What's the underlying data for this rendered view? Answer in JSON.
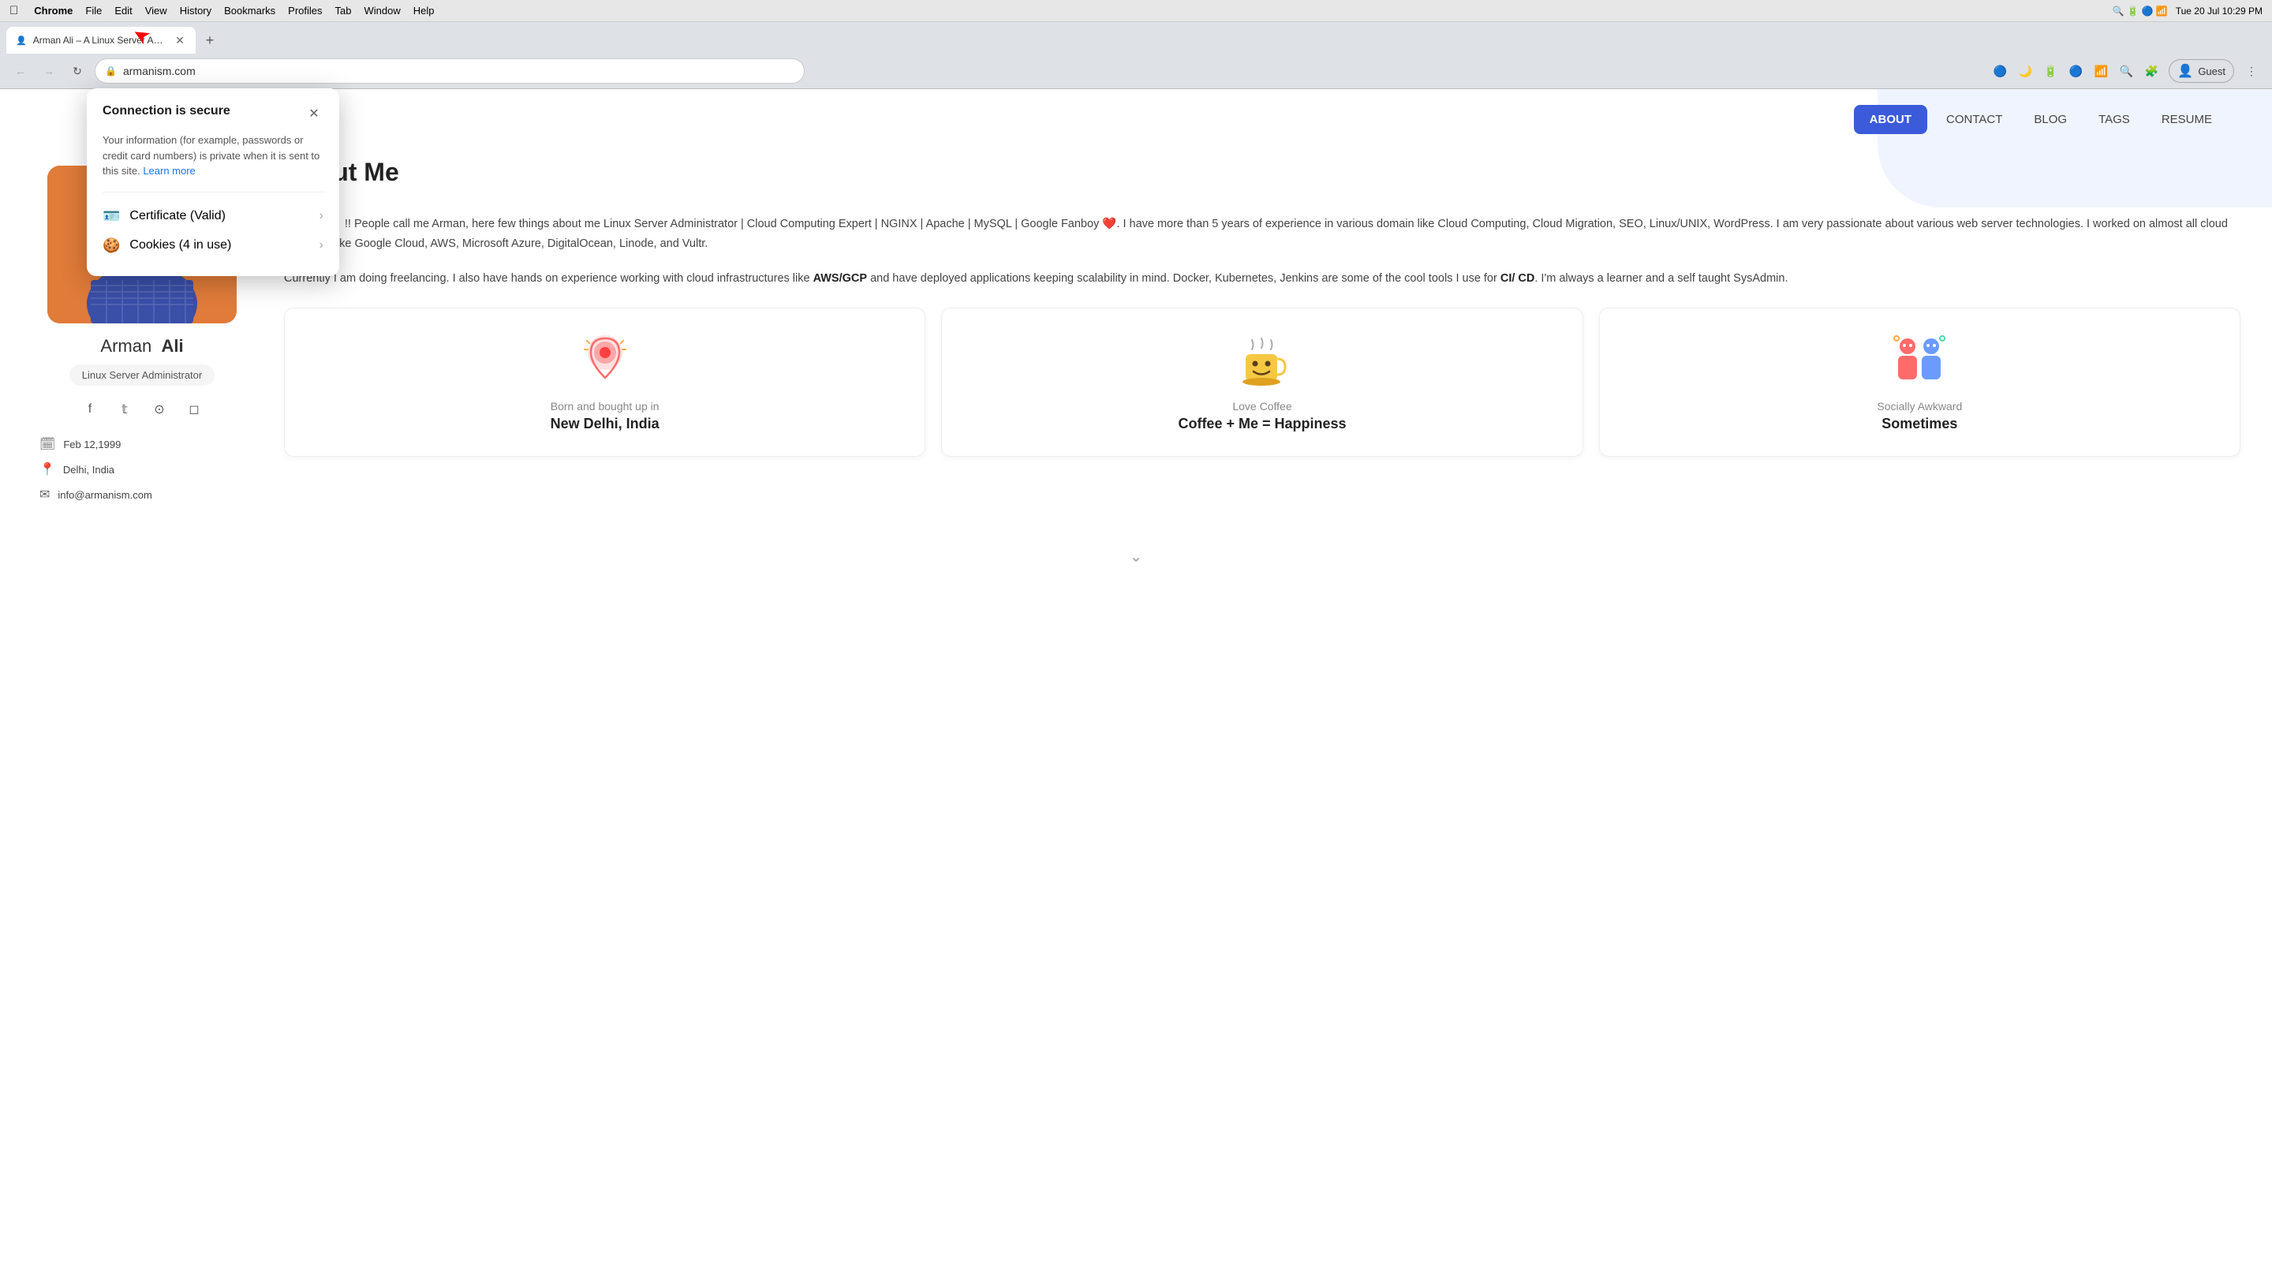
{
  "os": {
    "apple": "🍎",
    "menu_items": [
      "Chrome",
      "File",
      "Edit",
      "View",
      "History",
      "Bookmarks",
      "Profiles",
      "Tab",
      "Window",
      "Help"
    ],
    "time": "Tue 20 Jul  10:29 PM"
  },
  "browser": {
    "tab": {
      "title": "Arman Ali – A Linux Server Adm…",
      "favicon": "👤"
    },
    "url": "armanism.com",
    "profile": "Guest",
    "back_disabled": false,
    "forward_disabled": true
  },
  "security_popup": {
    "title": "Connection is secure",
    "body": "Your information (for example, passwords or credit card numbers) is private when it is sent to this site.",
    "learn_more": "Learn more",
    "certificate": {
      "label": "Certificate",
      "status": "(Valid)"
    },
    "cookies": {
      "label": "Cookies",
      "status": "(4 in use)"
    }
  },
  "nav": {
    "about_label": "ABOUT",
    "contact_label": "CONTACT",
    "blog_label": "BLOG",
    "tags_label": "TAGS",
    "resume_label": "RESUME"
  },
  "page": {
    "section_title": "About Me",
    "paragraph1": "Hi there 👋 !! People call me Arman, here few things about me Linux Server Administrator | Cloud Computing Expert | NGINX | Apache | MySQL | Google Fanboy ❤️. I have more than 5 years of experience in various domain like Cloud Computing, Cloud Migration, SEO, Linux/UNIX, WordPress. I am very passionate about various web server technologies. I worked on almost all cloud providers like Google Cloud, AWS, Microsoft Azure, DigitalOcean, Linode, and Vultr.",
    "paragraph2_prefix": "Currently I am doing freelancing. I also have hands on experience working with cloud infrastructures like ",
    "paragraph2_bold1": "AWS/GCP",
    "paragraph2_middle": " and have deployed applications keeping scalability in mind. Docker, Kubernetes, Jenkins are some of the cool tools I use for ",
    "paragraph2_bold2": "CI/ CD",
    "paragraph2_suffix": ". I'm always a learner and a self taught SysAdmin.",
    "cards": [
      {
        "icon": "📍",
        "subtitle": "Born and bought up in",
        "title": "New Delhi, India"
      },
      {
        "icon": "☕",
        "subtitle": "Love Coffee",
        "title": "Coffee + Me = Happiness"
      },
      {
        "icon": "🤝",
        "subtitle": "Socially Awkward",
        "title": "Sometimes"
      }
    ]
  },
  "sidebar": {
    "name_first": "Arman",
    "name_last": "Ali",
    "role": "Linux Server Administrator",
    "socials": [
      "f",
      "t",
      "gh",
      "ig"
    ],
    "meta": [
      {
        "icon": "📅",
        "text": "Feb 12,1999"
      },
      {
        "icon": "📍",
        "text": "Delhi, India"
      },
      {
        "icon": "✉️",
        "text": "info@armanism.com"
      }
    ]
  }
}
